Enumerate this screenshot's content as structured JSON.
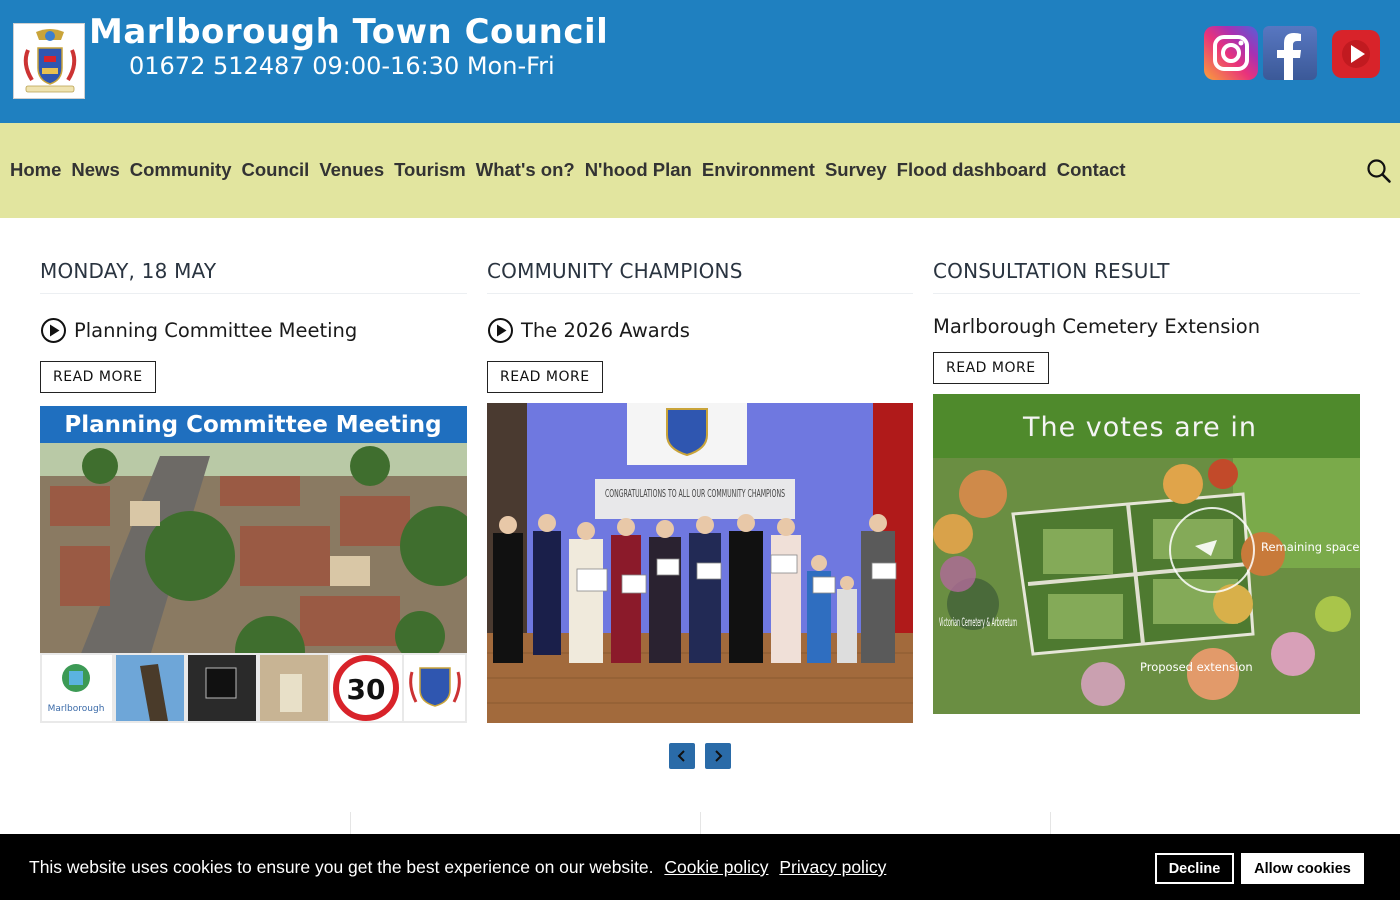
{
  "header": {
    "title": "Marlborough Town Council",
    "phone": "01672 512487 09:00-16:30 Mon-Fri",
    "brand_color": "#1f80c0",
    "social": [
      {
        "icon": "instagram-icon"
      },
      {
        "icon": "facebook-icon"
      },
      {
        "icon": "youtube-icon"
      }
    ]
  },
  "nav": {
    "background": "#e2e59f",
    "items": [
      "Home",
      "News",
      "Community",
      "Council",
      "Venues",
      "Tourism",
      "What's on?",
      "N'hood Plan",
      "Environment",
      "Survey",
      "Flood dashboard",
      "Contact"
    ],
    "search_icon": "search-icon"
  },
  "columns": [
    {
      "heading": "MONDAY, 18 MAY",
      "title": "Planning Committee Meeting",
      "has_play_icon": true,
      "button": "READ MORE",
      "image_banner": "Planning Committee Meeting",
      "image_sign": "30",
      "image_logo_text": "Marlborough"
    },
    {
      "heading": "COMMUNITY CHAMPIONS",
      "title": "The 2026 Awards",
      "has_play_icon": true,
      "button": "READ MORE",
      "image_screen_text": "CONGRATULATIONS TO ALL OUR COMMUNITY CHAMPIONS"
    },
    {
      "heading": "CONSULTATION RESULT",
      "title": "Marlborough Cemetery Extension",
      "has_play_icon": false,
      "button": "READ MORE",
      "image_banner": "The votes are in",
      "image_labels": {
        "remaining": "Remaining space",
        "victorian": "Victorian Cemetery & Arboretum",
        "proposed": "Proposed extension"
      }
    }
  ],
  "carousel": {
    "prev_icon": "chevron-left-icon",
    "next_icon": "chevron-right-icon",
    "accent": "#2a6ba8"
  },
  "cookie": {
    "text": "This website uses cookies to ensure you get the best experience on our website.",
    "cookie_policy": "Cookie policy",
    "privacy_policy": "Privacy policy",
    "decline": "Decline",
    "allow": "Allow cookies"
  }
}
